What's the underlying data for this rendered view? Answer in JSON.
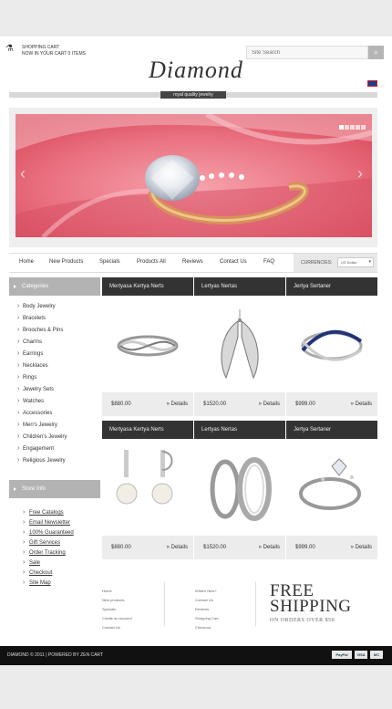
{
  "header": {
    "cart_title": "SHOPPING CART",
    "cart_status": "NOW IN YOUR CART 0 ITEMS",
    "search_placeholder": "Site Search",
    "logo": "Diamond",
    "tagline": "royal quality jewelry"
  },
  "nav": {
    "items": [
      "Home",
      "New Products",
      "Specials",
      "Products All",
      "Reviews",
      "Contact Us",
      "FAQ"
    ],
    "currencies_label": "CURRENCIES:",
    "currency_value": "US Dollar"
  },
  "sidebar": {
    "categories_title": "Categories",
    "categories": [
      "Body Jewelry",
      "Bracelets",
      "Brooches & Pins",
      "Charms",
      "Earrings",
      "Necklaces",
      "Rings",
      "Jewelry Sets",
      "Watches",
      "Accessories",
      "Men's Jewelry",
      "Children's Jewelry",
      "Engagement",
      "Religious Jewelry"
    ],
    "store_info_title": "Store Info",
    "store_info": [
      "Free Catalogs",
      "Email Newsletter",
      "100% Guaranteed",
      "Gift Services",
      "Order Tracking",
      "Sale",
      "Checkout",
      "Site Map"
    ]
  },
  "products": [
    {
      "title": "Mertyasa Kertya Nerts",
      "price": "$880.00",
      "details": "» Details",
      "icon": "twisted-ring-icon"
    },
    {
      "title": "Lertyas Nertas",
      "price": "$1520.00",
      "details": "» Details",
      "icon": "angel-wings-pendant-icon"
    },
    {
      "title": "Jertya Sertaner",
      "price": "$999.00",
      "details": "» Details",
      "icon": "sapphire-ring-icon"
    },
    {
      "title": "Mertyasa Kertya Nerts",
      "price": "$880.00",
      "details": "» Details",
      "icon": "pearl-earrings-icon"
    },
    {
      "title": "Lertyas Nertas",
      "price": "$1520.00",
      "details": "» Details",
      "icon": "hoop-earrings-icon"
    },
    {
      "title": "Jertya Sertaner",
      "price": "$999.00",
      "details": "» Details",
      "icon": "diamond-ring-icon"
    }
  ],
  "footer": {
    "col1": [
      "Home",
      "New products",
      "Specials",
      "Create an account",
      "Contact Us"
    ],
    "col2": [
      "What's New?",
      "Contact Us",
      "Reviews",
      "Shopping Cart",
      "Checkout"
    ],
    "free_line1": "FREE",
    "free_line2": "SHIPPING",
    "free_line3": "ON ORDERS OVER $50",
    "copyright": "DIAMOND © 2011 | POWERED BY ZEN CART",
    "payments": [
      "PayPal",
      "VISA",
      "MC"
    ]
  },
  "colors": {
    "accent_dark": "#333333",
    "sidebar_head": "#b3b3b3",
    "slider_bg": "#ef7e8a"
  }
}
